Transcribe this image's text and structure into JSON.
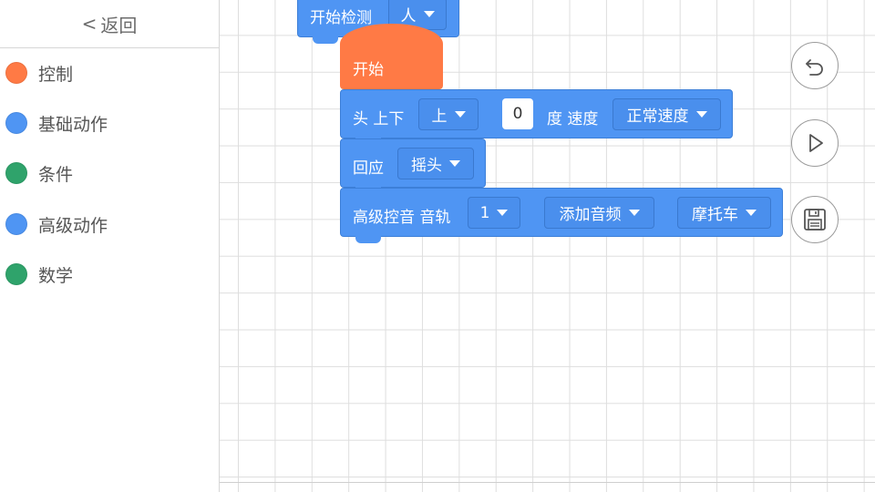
{
  "sidebar": {
    "back_label": "返回",
    "back_arrow": "<",
    "categories": [
      {
        "label": "控制",
        "color": "#ff7a45"
      },
      {
        "label": "基础动作",
        "color": "#4f95f3"
      },
      {
        "label": "条件",
        "color": "#2fa36b"
      },
      {
        "label": "高级动作",
        "color": "#4f95f3"
      },
      {
        "label": "数学",
        "color": "#2fa36b"
      }
    ]
  },
  "blocks": {
    "detect": {
      "label": "开始检测",
      "dropdown": "人"
    },
    "start": {
      "label": "开始"
    },
    "head": {
      "label_a": "头 上下",
      "direction": "上",
      "degrees": "0",
      "label_b": "度 速度",
      "speed": "正常速度"
    },
    "respond": {
      "label": "回应",
      "action": "摇头"
    },
    "audio": {
      "label": "高级控音 音轨",
      "track": "1",
      "add": "添加音频",
      "sound": "摩托车"
    }
  },
  "colors": {
    "control": "#ff7a45",
    "motion": "#4f95f3",
    "condition": "#2fa36b"
  },
  "controls": [
    "undo-icon",
    "play-icon",
    "save-icon"
  ]
}
